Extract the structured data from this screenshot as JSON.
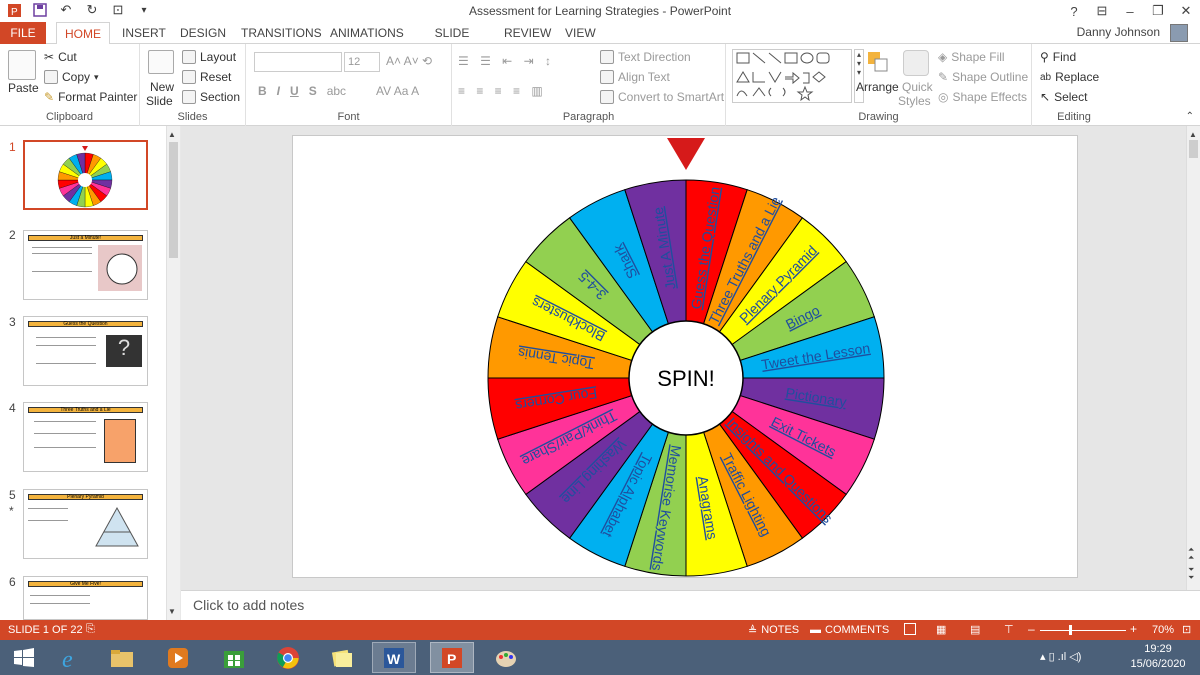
{
  "window": {
    "title": "Assessment for Learning Strategies - PowerPoint",
    "help": "?",
    "user_name": "Danny Johnson"
  },
  "tabs": [
    "FILE",
    "HOME",
    "INSERT",
    "DESIGN",
    "TRANSITIONS",
    "ANIMATIONS",
    "SLIDE SHOW",
    "REVIEW",
    "VIEW"
  ],
  "ribbon": {
    "clipboard": {
      "label": "Clipboard",
      "paste": "Paste",
      "cut": "Cut",
      "copy": "Copy",
      "format_painter": "Format Painter"
    },
    "slides": {
      "label": "Slides",
      "new_slide": "New Slide",
      "new_slide_line1": "New",
      "new_slide_line2": "Slide",
      "layout": "Layout",
      "reset": "Reset",
      "section": "Section"
    },
    "font": {
      "label": "Font",
      "size": "12"
    },
    "paragraph": {
      "label": "Paragraph",
      "text_direction": "Text Direction",
      "align_text": "Align Text",
      "convert_smartart": "Convert to SmartArt"
    },
    "drawing": {
      "label": "Drawing",
      "arrange": "Arrange",
      "quick_styles_1": "Quick",
      "quick_styles_2": "Styles",
      "shape_fill": "Shape Fill",
      "shape_outline": "Shape Outline",
      "shape_effects": "Shape Effects"
    },
    "editing": {
      "label": "Editing",
      "find": "Find",
      "replace": "Replace",
      "select": "Select"
    }
  },
  "thumbnails": [
    {
      "num": "1",
      "title": ""
    },
    {
      "num": "2",
      "title": "Just a Minute!"
    },
    {
      "num": "3",
      "title": "Guess the Question"
    },
    {
      "num": "4",
      "title": "Three Truths and a Lie"
    },
    {
      "num": "5",
      "title": "Plenary Pyramid"
    },
    {
      "num": "6",
      "title": "Give Me Five!"
    }
  ],
  "slide": {
    "center_label": "SPIN!",
    "segments": [
      {
        "label": "Guess the Question",
        "color": "#ff0000"
      },
      {
        "label": "Three Truths and a Lie",
        "color": "#ff9900"
      },
      {
        "label": "Plenary Pyramid",
        "color": "#ffff00"
      },
      {
        "label": "Bingo",
        "color": "#92d050"
      },
      {
        "label": "Tweet the Lesson",
        "color": "#00b0f0"
      },
      {
        "label": "Pictionary",
        "color": "#7030a0"
      },
      {
        "label": "Exit Tickets",
        "color": "#ff3399"
      },
      {
        "label": "Insights and Questions",
        "color": "#ff0000"
      },
      {
        "label": "Traffic Lighting",
        "color": "#ff9900"
      },
      {
        "label": "Anagrams",
        "color": "#ffff00"
      },
      {
        "label": "Memorise Keywords",
        "color": "#92d050"
      },
      {
        "label": "Topic Alphabet",
        "color": "#00b0f0"
      },
      {
        "label": "Washing Line",
        "color": "#7030a0"
      },
      {
        "label": "Think/Pair/Share",
        "color": "#ff3399"
      },
      {
        "label": "Four Corners",
        "color": "#ff0000"
      },
      {
        "label": "Topic Tennis",
        "color": "#ff9900"
      },
      {
        "label": "Blockbusters",
        "color": "#ffff00"
      },
      {
        "label": "3-4-5",
        "color": "#92d050"
      },
      {
        "label": "Shark",
        "color": "#00b0f0"
      },
      {
        "label": "Just A Minute",
        "color": "#7030a0"
      }
    ]
  },
  "notes_placeholder": "Click to add notes",
  "status": {
    "slide_of": "SLIDE 1 OF 22",
    "notes": "NOTES",
    "comments": "COMMENTS",
    "zoom": "70%"
  },
  "taskbar": {
    "time": "19:29",
    "date": "15/06/2020"
  }
}
